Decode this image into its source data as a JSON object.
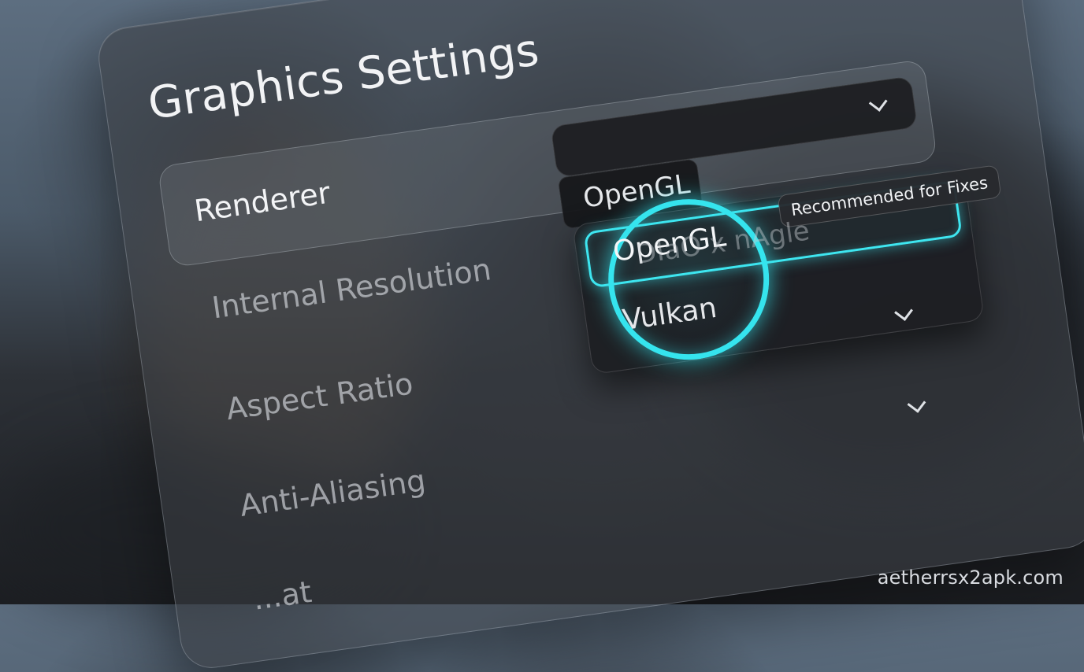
{
  "window": {
    "title": "Graphics Settings"
  },
  "renderer": {
    "label": "Renderer",
    "selected": "OpenGL",
    "options": [
      {
        "label": "OpenGL",
        "badge": "Recommended for Fixes",
        "highlighted": true
      },
      {
        "label": "Vulkan",
        "highlighted": false
      }
    ]
  },
  "settings": [
    {
      "label": "Internal Resolution",
      "value": "DIaO x nAgle"
    },
    {
      "label": "Aspect Ratio"
    },
    {
      "label": "Anti-Aliasing"
    },
    {
      "label": "...at"
    }
  ],
  "watermark": "aetherrsx2apk.com",
  "colors": {
    "accent": "#3ee6f0",
    "panel": "#3c4046",
    "text": "#f2f3f5"
  }
}
